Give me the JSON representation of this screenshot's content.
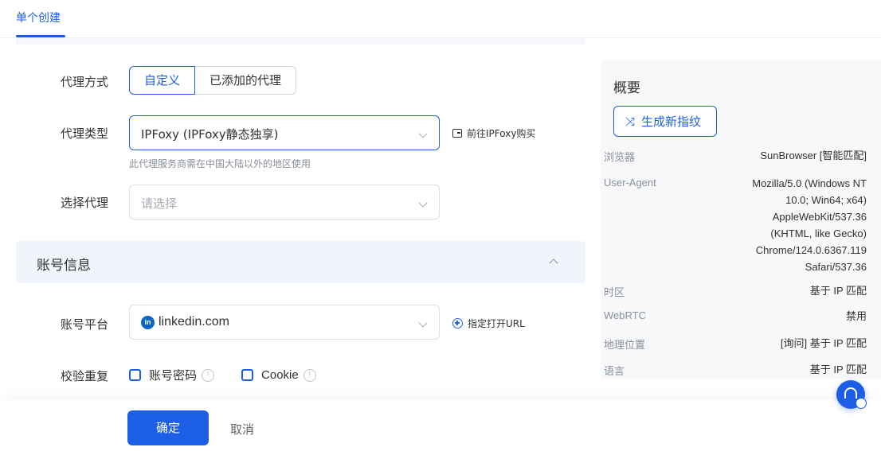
{
  "tab": {
    "label": "单个创建"
  },
  "form": {
    "proxy_mode": {
      "label": "代理方式",
      "options": [
        "自定义",
        "已添加的代理"
      ]
    },
    "proxy_type": {
      "label": "代理类型",
      "value": "IPFoxy (IPFoxy静态独享)",
      "hint": "此代理服务商需在中国大陆以外的地区使用",
      "link": "前往IPFoxy购买"
    },
    "select_proxy": {
      "label": "选择代理",
      "placeholder": "请选择"
    },
    "account_section": {
      "title": "账号信息"
    },
    "platform": {
      "label": "账号平台",
      "value": "linkedin.com",
      "logo": "in",
      "link": "指定打开URL"
    },
    "dedupe": {
      "label": "校验重复",
      "options": [
        "账号密码",
        "Cookie"
      ]
    }
  },
  "footer": {
    "confirm": "确定",
    "cancel": "取消"
  },
  "summary": {
    "title": "概要",
    "generate_button": "生成新指纹",
    "items": [
      {
        "key": "浏览器",
        "value": "SunBrowser [智能匹配]"
      },
      {
        "key": "User-Agent",
        "value_lines": [
          "Mozilla/5.0 (Windows NT",
          "10.0; Win64; x64)",
          "AppleWebKit/537.36",
          "(KHTML, like Gecko)",
          "Chrome/124.0.6367.119",
          "Safari/537.36"
        ]
      },
      {
        "key": "时区",
        "value": "基于 IP 匹配"
      },
      {
        "key": "WebRTC",
        "value": "禁用"
      },
      {
        "key": "地理位置",
        "value": "[询问] 基于 IP 匹配"
      },
      {
        "key": "语言",
        "value": "基于 IP 匹配"
      }
    ]
  },
  "colors": {
    "primary": "#1c5fe6",
    "linkedin": "#0a66c2"
  },
  "icons": [
    "external-link-icon",
    "chevron-down-icon",
    "chevron-up-icon",
    "plus-circle-icon",
    "info-icon",
    "shuffle-icon",
    "headset-icon",
    "linkedin-logo-icon"
  ]
}
